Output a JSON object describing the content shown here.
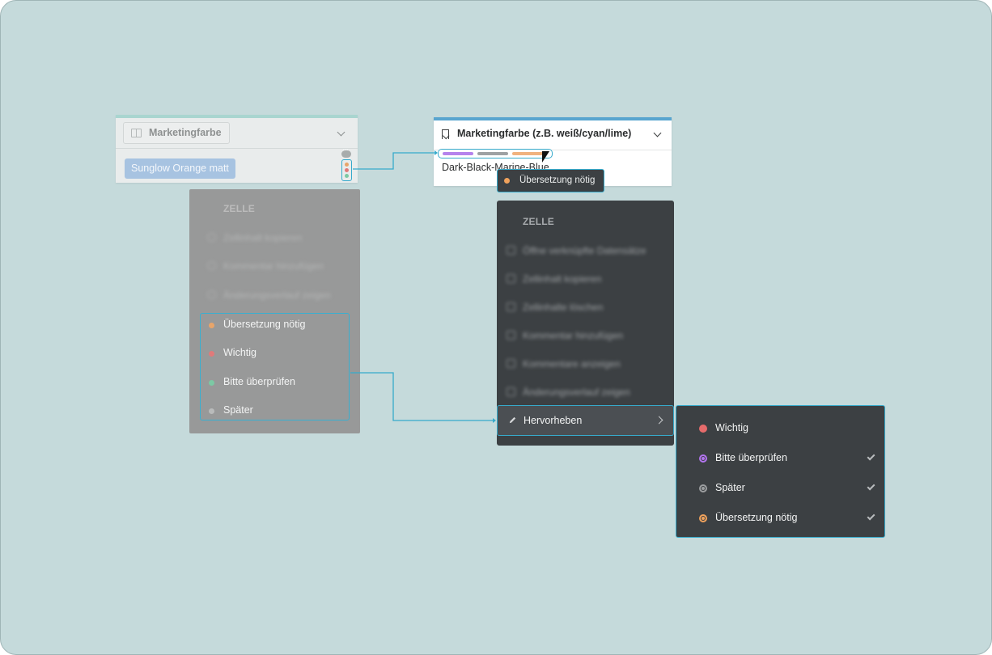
{
  "left_card": {
    "field_chip_label": "Marketingfarbe",
    "value_chip": "Sunglow Orange matt"
  },
  "left_menu": {
    "section_header": "ZELLE",
    "items": [
      "Zellinhalt kopieren",
      "Kommentar hinzufügen",
      "Änderungsverlauf zeigen"
    ],
    "highlight_options": [
      {
        "label": "Übersetzung nötig",
        "color": "#e8a56a"
      },
      {
        "label": "Wichtig",
        "color": "#e07a7a"
      },
      {
        "label": "Bitte überprüfen",
        "color": "#7cc9a4"
      },
      {
        "label": "Später",
        "color": "#b9bbbb"
      }
    ]
  },
  "right_card": {
    "title": "Marketingfarbe (z.B. weiß/cyan/lime)",
    "value": "Dark-Black-Marine-Blue",
    "marker_colors": [
      "#b583ec",
      "#9ea1a3",
      "#f0b27f"
    ],
    "tooltip": {
      "label": "Übersetzung nötig",
      "color": "#f0a25c"
    }
  },
  "right_menu": {
    "section_header": "ZELLE",
    "items": [
      "Öffne verknüpfte Datensätze",
      "Zellinhalt kopieren",
      "Zellinhalte löschen",
      "Kommentar hinzufügen",
      "Kommentare anzeigen",
      "Änderungsverlauf zeigen"
    ],
    "active_item": "Hervorheben"
  },
  "submenu": {
    "items": [
      {
        "label": "Wichtig",
        "color": "#e66b6b",
        "checked": false,
        "style": "dot"
      },
      {
        "label": "Bitte überprüfen",
        "color": "#b274ee",
        "checked": true,
        "style": "ring"
      },
      {
        "label": "Später",
        "color": "#9c9ea0",
        "checked": true,
        "style": "ring"
      },
      {
        "label": "Übersetzung nötig",
        "color": "#f0a25c",
        "checked": true,
        "style": "ring"
      }
    ]
  },
  "accent_color": "#36aacb"
}
